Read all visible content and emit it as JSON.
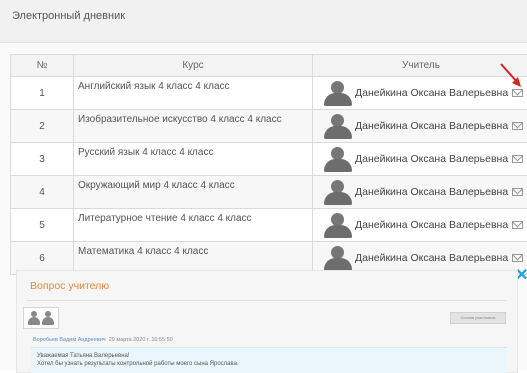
{
  "header": {
    "title": "Электронный дневник"
  },
  "table": {
    "columns": [
      "№",
      "Курс",
      "Учитель"
    ],
    "rows": [
      {
        "num": "1",
        "course": "Английский язык 4 класс 4 класс",
        "teacher": "Данейкина Оксана Валерьевна"
      },
      {
        "num": "2",
        "course": "Изобразительное искусство 4 класс 4 класс",
        "teacher": "Данейкина Оксана Валерьевна"
      },
      {
        "num": "3",
        "course": "Русский язык 4 класс 4 класс",
        "teacher": "Данейкина Оксана Валерьевна"
      },
      {
        "num": "4",
        "course": "Окружающий мир 4 класс 4 класс",
        "teacher": "Данейкина Оксана Валерьевна"
      },
      {
        "num": "5",
        "course": "Литературное чтение 4 класс 4 класс",
        "teacher": "Данейкина Оксана Валерьевна"
      },
      {
        "num": "6",
        "course": "Математика 4 класс 4 класс",
        "teacher": "Данейкина Оксана Валерьевна"
      }
    ]
  },
  "question": {
    "title": "Вопрос учителю",
    "button_label": "Состав участников",
    "author": "Воробьев Вадим Андреевич",
    "date": "29 марта 2020 г. 10:55:50",
    "message_line1": "Уважаемая Татьяна Валерьевна!",
    "message_line2": "Хотел бы узнать результаты контрольной работы моего сына Ярослава."
  },
  "icons": {
    "mail": "envelope-icon",
    "avatar": "user-avatar-icon",
    "close": "close-icon",
    "arrow": "red-arrow-annotation"
  },
  "colors": {
    "accent_orange": "#e8873a",
    "close_blue": "#1aa3d9",
    "arrow_red": "#d9231c"
  }
}
